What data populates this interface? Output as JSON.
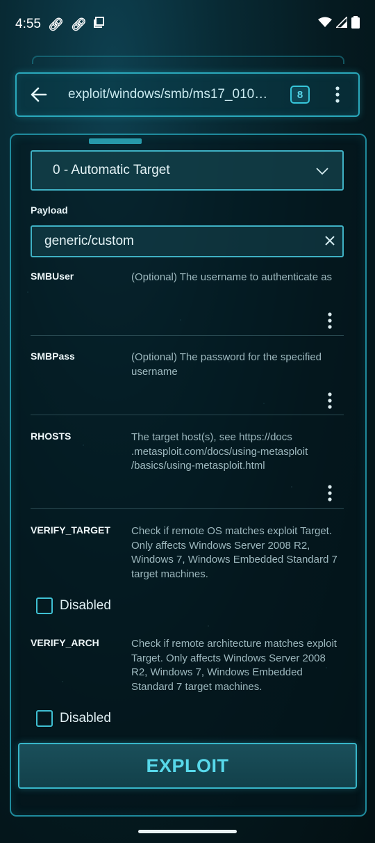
{
  "status_bar": {
    "time": "4:55",
    "icons": [
      "link-icon",
      "link-icon",
      "screen-icon"
    ],
    "right_icons": [
      "wifi-icon",
      "signal-icon",
      "battery-icon"
    ]
  },
  "app_bar": {
    "module_path": "exploit/windows/smb/ms17_010…",
    "count": "8"
  },
  "target": {
    "selected": "0 - Automatic Target"
  },
  "payload": {
    "label": "Payload",
    "value": "generic/custom"
  },
  "options": [
    {
      "name": "SMBUser",
      "desc": "(Optional) The username to authenticate as"
    },
    {
      "name": "SMBPass",
      "desc": "(Optional) The password for the specified username"
    },
    {
      "name": "RHOSTS",
      "desc": "The target host(s), see https://docs .metasploit.com/docs/using-metasploit /basics/using-metasploit.html"
    },
    {
      "name": "VERIFY_TARGET",
      "desc": "Check if remote OS matches exploit Target. Only affects Windows Server 2008 R2, Windows 7, Windows Embedded Standard 7 target machines.",
      "checkbox_label": "Disabled"
    },
    {
      "name": "VERIFY_ARCH",
      "desc": "Check if remote architecture matches exploit Target. Only affects Windows Server 2008 R2, Windows 7, Windows Embedded Standard 7 target machines.",
      "checkbox_label": "Disabled"
    }
  ],
  "exploit_button": {
    "label": "EXPLOIT"
  },
  "colors": {
    "accent": "#37c6da",
    "background": "#051a20"
  }
}
